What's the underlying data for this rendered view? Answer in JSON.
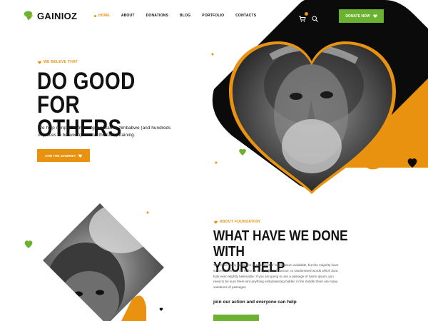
{
  "brand": {
    "name": "GAINIOZ"
  },
  "nav": {
    "items": [
      {
        "label": "HOME",
        "active": true
      },
      {
        "label": "ABOUT",
        "active": false
      },
      {
        "label": "DONATIONS",
        "active": false
      },
      {
        "label": "BLOG",
        "active": false
      },
      {
        "label": "PORTFOLIO",
        "active": false
      },
      {
        "label": "CONTACTS",
        "active": false
      }
    ],
    "donate_label": "DONATE NOW"
  },
  "hero": {
    "kicker": "WE BELEVE THAT",
    "title_line1": "DO GOOD FOR",
    "title_line2": "OTHERS",
    "description": "We help nonprofits from afghanistan to zimbabwe (and hundreds of places in between) access the tools, training.",
    "cta_label": "JOIN THE JOURNEY"
  },
  "section": {
    "kicker": "ABOUT FOUNDATION",
    "title_line1": "WHAT HAVE WE DONE WITH",
    "title_line2": "YOUR HELP",
    "body": "There are many variations of passages of lorem ipsum available, but the majority have suffered alteration in some form, by injected humour, or randomised words which dont look even slightly believable. If you are going to use a passage of lorem ipsum, you need to be sure there isnt anything embarrassing hidden in the middle there are many variations of passages",
    "strong_text": "join our action and everyone can help"
  },
  "icons": {
    "cart": "cart-icon",
    "search": "search-icon",
    "heart": "heart-icon"
  },
  "colors": {
    "orange": "#e8920f",
    "green": "#6ab22f",
    "black": "#0b0b0b"
  }
}
